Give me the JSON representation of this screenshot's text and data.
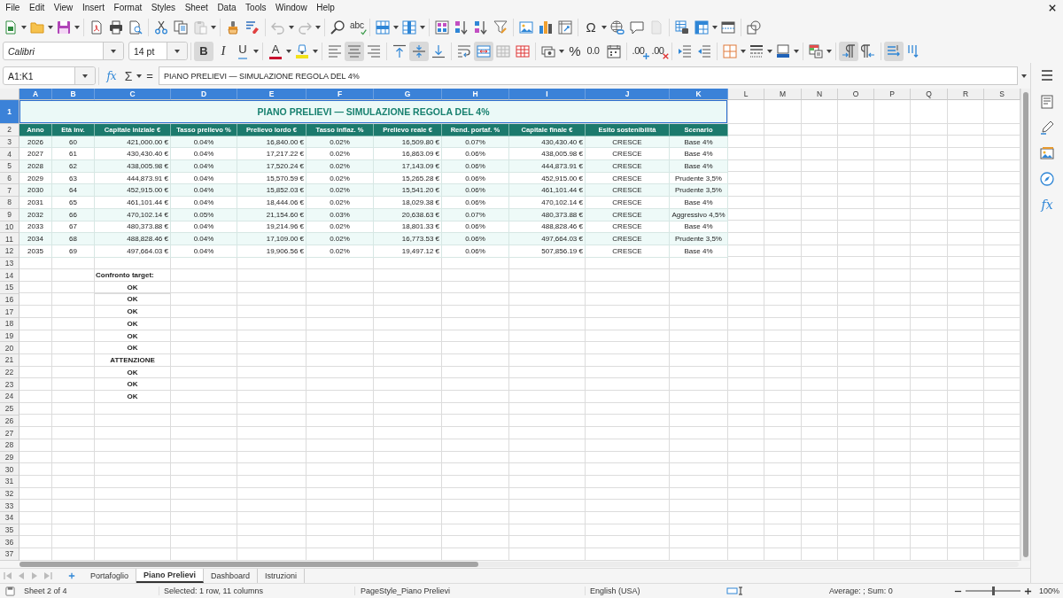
{
  "menu_bar": {
    "items": [
      "File",
      "Edit",
      "View",
      "Insert",
      "Format",
      "Styles",
      "Sheet",
      "Data",
      "Tools",
      "Window",
      "Help"
    ]
  },
  "standard_toolbar": [
    [
      {
        "kind": "new",
        "dropdown": true,
        "disabled": false
      },
      {
        "kind": "open",
        "dropdown": true,
        "disabled": false
      },
      {
        "kind": "save",
        "dropdown": true,
        "disabled": false
      }
    ],
    [
      {
        "kind": "pdf",
        "disabled": false
      },
      {
        "kind": "print",
        "disabled": false
      },
      {
        "kind": "preview",
        "disabled": false
      }
    ],
    [
      {
        "kind": "cut",
        "disabled": false
      },
      {
        "kind": "copy",
        "disabled": false
      },
      {
        "kind": "paste",
        "dropdown": true,
        "disabled": true
      }
    ],
    [
      {
        "kind": "clone",
        "disabled": false
      },
      {
        "kind": "clear",
        "disabled": false
      }
    ],
    [
      {
        "kind": "undo",
        "dropdown": true,
        "disabled": true
      },
      {
        "kind": "redo",
        "dropdown": true,
        "disabled": true
      }
    ],
    [
      {
        "kind": "find",
        "disabled": false
      },
      {
        "kind": "spelling",
        "glyph": "abc",
        "disabled": false
      }
    ],
    [
      {
        "kind": "row",
        "dropdown": true,
        "disabled": false
      },
      {
        "kind": "column",
        "dropdown": true,
        "disabled": false
      }
    ],
    [
      {
        "kind": "sort",
        "disabled": false
      },
      {
        "kind": "sort-asc",
        "disabled": false
      },
      {
        "kind": "sort-desc",
        "disabled": false
      },
      {
        "kind": "filter",
        "disabled": false
      }
    ],
    [
      {
        "kind": "image",
        "disabled": false
      },
      {
        "kind": "chart",
        "disabled": false
      },
      {
        "kind": "pivot",
        "disabled": false
      }
    ],
    [
      {
        "kind": "special",
        "glyph": "Ω",
        "dropdown": true,
        "disabled": false
      },
      {
        "kind": "link",
        "disabled": false
      },
      {
        "kind": "comment",
        "disabled": false
      },
      {
        "kind": "header",
        "disabled": true
      }
    ],
    [
      {
        "kind": "print-area",
        "disabled": false
      },
      {
        "kind": "freeze",
        "dropdown": true,
        "disabled": false
      },
      {
        "kind": "split",
        "disabled": false
      }
    ],
    [
      {
        "kind": "draw",
        "disabled": false
      }
    ]
  ],
  "formatting_toolbar": {
    "font_name": "Calibri",
    "font_size": "14 pt",
    "groups": [
      [
        {
          "kind": "bold",
          "glyph": "B",
          "pressed": true
        },
        {
          "kind": "italic",
          "glyph": "I",
          "pressed": false
        },
        {
          "kind": "underline",
          "glyph": "U",
          "dropdown": true,
          "pressed": false
        }
      ],
      [
        {
          "kind": "font-color",
          "glyph": "A",
          "dropdown": true,
          "pressed": false
        },
        {
          "kind": "highlight",
          "dropdown": true,
          "pressed": false
        }
      ],
      [
        {
          "kind": "align-left",
          "pressed": false
        },
        {
          "kind": "align-center",
          "pressed": true
        },
        {
          "kind": "align-right",
          "pressed": false
        }
      ],
      [
        {
          "kind": "align-top",
          "pressed": false
        },
        {
          "kind": "align-middle",
          "pressed": true
        },
        {
          "kind": "align-bottom",
          "pressed": false
        }
      ],
      [
        {
          "kind": "wrap",
          "pressed": false
        },
        {
          "kind": "merge-center",
          "pressed": true
        },
        {
          "kind": "merge",
          "pressed": false
        },
        {
          "kind": "unmerge",
          "pressed": false
        }
      ],
      [
        {
          "kind": "currency",
          "dropdown": true,
          "pressed": false
        },
        {
          "kind": "percent",
          "glyph": "%",
          "pressed": false
        },
        {
          "kind": "number",
          "glyph": "0.0",
          "pressed": false
        },
        {
          "kind": "date",
          "pressed": false
        }
      ],
      [
        {
          "kind": "add-decimal",
          "glyph": ".00",
          "pressed": false
        },
        {
          "kind": "delete-decimal",
          "glyph": ".00",
          "pressed": false
        }
      ],
      [
        {
          "kind": "indent",
          "pressed": false
        },
        {
          "kind": "outdent",
          "pressed": false
        }
      ],
      [
        {
          "kind": "borders",
          "dropdown": true,
          "pressed": false
        },
        {
          "kind": "border-style",
          "dropdown": true,
          "pressed": false
        },
        {
          "kind": "border-color",
          "dropdown": true,
          "pressed": false
        }
      ],
      [
        {
          "kind": "conditional",
          "dropdown": true,
          "pressed": false
        }
      ],
      [
        {
          "kind": "ltr",
          "pressed": true
        },
        {
          "kind": "rtl",
          "pressed": false
        }
      ],
      [
        {
          "kind": "text-ltr",
          "pressed": true
        },
        {
          "kind": "text-ttb",
          "pressed": false
        }
      ]
    ]
  },
  "formula_bar": {
    "name_box": "A1:K1",
    "wizard": "fx",
    "sum": "Σ",
    "equals": "=",
    "content": "PIANO PRELIEVI — SIMULAZIONE REGOLA DEL 4%"
  },
  "sidebar": [
    {
      "kind": "menu"
    },
    {
      "kind": "properties"
    },
    {
      "kind": "styles"
    },
    {
      "kind": "gallery"
    },
    {
      "kind": "navigator"
    },
    {
      "kind": "functions",
      "glyph": "fx"
    }
  ],
  "sheet": {
    "column_headers": [
      {
        "label": "A",
        "selected": true
      },
      {
        "label": "B",
        "selected": true
      },
      {
        "label": "C",
        "selected": true
      },
      {
        "label": "D",
        "selected": true
      },
      {
        "label": "E",
        "selected": true
      },
      {
        "label": "F",
        "selected": true
      },
      {
        "label": "G",
        "selected": true
      },
      {
        "label": "H",
        "selected": true
      },
      {
        "label": "I",
        "selected": true
      },
      {
        "label": "J",
        "selected": true
      },
      {
        "label": "K",
        "selected": true
      },
      {
        "label": "L",
        "selected": false
      },
      {
        "label": "M",
        "selected": false
      },
      {
        "label": "N",
        "selected": false
      },
      {
        "label": "O",
        "selected": false
      },
      {
        "label": "P",
        "selected": false
      },
      {
        "label": "Q",
        "selected": false
      },
      {
        "label": "R",
        "selected": false
      },
      {
        "label": "S",
        "selected": false
      }
    ],
    "row_headers": [
      {
        "label": "1",
        "selected": true
      },
      {
        "label": "2",
        "selected": false
      },
      {
        "label": "3",
        "selected": false
      },
      {
        "label": "4",
        "selected": false
      },
      {
        "label": "5",
        "selected": false
      },
      {
        "label": "6",
        "selected": false
      },
      {
        "label": "7",
        "selected": false
      },
      {
        "label": "8",
        "selected": false
      },
      {
        "label": "9",
        "selected": false
      },
      {
        "label": "10",
        "selected": false
      },
      {
        "label": "11",
        "selected": false
      },
      {
        "label": "12",
        "selected": false
      },
      {
        "label": "13",
        "selected": false
      },
      {
        "label": "14",
        "selected": false
      },
      {
        "label": "15",
        "selected": false
      },
      {
        "label": "16",
        "selected": false
      },
      {
        "label": "17",
        "selected": false
      },
      {
        "label": "18",
        "selected": false
      },
      {
        "label": "19",
        "selected": false
      },
      {
        "label": "20",
        "selected": false
      },
      {
        "label": "21",
        "selected": false
      },
      {
        "label": "22",
        "selected": false
      },
      {
        "label": "23",
        "selected": false
      },
      {
        "label": "24",
        "selected": false
      },
      {
        "label": "25",
        "selected": false
      },
      {
        "label": "26",
        "selected": false
      },
      {
        "label": "27",
        "selected": false
      },
      {
        "label": "28",
        "selected": false
      },
      {
        "label": "29",
        "selected": false
      },
      {
        "label": "30",
        "selected": false
      },
      {
        "label": "31",
        "selected": false
      },
      {
        "label": "32",
        "selected": false
      },
      {
        "label": "33",
        "selected": false
      },
      {
        "label": "34",
        "selected": false
      },
      {
        "label": "35",
        "selected": false
      },
      {
        "label": "36",
        "selected": false
      },
      {
        "label": "37",
        "selected": false
      }
    ],
    "title": {
      "text": "PIANO PRELIEVI — SIMULAZIONE REGOLA DEL 4%",
      "selected": true
    },
    "table": {
      "headings": [
        {
          "text": "Anno",
          "kind": "text"
        },
        {
          "text": "Età inv.",
          "kind": "text"
        },
        {
          "text": "Capitale iniziale €",
          "kind": "amount"
        },
        {
          "text": "Tasso prelievo %",
          "kind": "text"
        },
        {
          "text": "Prelievo lordo €",
          "kind": "amount"
        },
        {
          "text": "Tasso inflaz. %",
          "kind": "text"
        },
        {
          "text": "Prelievo reale €",
          "kind": "amount"
        },
        {
          "text": "Rend. portaf. %",
          "kind": "text"
        },
        {
          "text": "Capitale finale €",
          "kind": "amount"
        },
        {
          "text": "Esito sostenibilità",
          "kind": "text"
        },
        {
          "text": "Scenario",
          "kind": "text"
        }
      ],
      "rows": [
        [
          "2026",
          "60",
          "421,000.00 €",
          "0.04%",
          "16,840.00 €",
          "0.02%",
          "16,509.80 €",
          "0.07%",
          "430,430.40 €",
          "CRESCE",
          "Base 4%"
        ],
        [
          "2027",
          "61",
          "430,430.40 €",
          "0.04%",
          "17,217.22 €",
          "0.02%",
          "16,863.09 €",
          "0.06%",
          "438,005.98 €",
          "CRESCE",
          "Base 4%"
        ],
        [
          "2028",
          "62",
          "438,005.98 €",
          "0.04%",
          "17,520.24 €",
          "0.02%",
          "17,143.09 €",
          "0.06%",
          "444,873.91 €",
          "CRESCE",
          "Base 4%"
        ],
        [
          "2029",
          "63",
          "444,873.91 €",
          "0.04%",
          "15,570.59 €",
          "0.02%",
          "15,265.28 €",
          "0.06%",
          "452,915.00 €",
          "CRESCE",
          "Prudente 3,5%"
        ],
        [
          "2030",
          "64",
          "452,915.00 €",
          "0.04%",
          "15,852.03 €",
          "0.02%",
          "15,541.20 €",
          "0.06%",
          "461,101.44 €",
          "CRESCE",
          "Prudente 3,5%"
        ],
        [
          "2031",
          "65",
          "461,101.44 €",
          "0.04%",
          "18,444.06 €",
          "0.02%",
          "18,029.38 €",
          "0.06%",
          "470,102.14 €",
          "CRESCE",
          "Base 4%"
        ],
        [
          "2032",
          "66",
          "470,102.14 €",
          "0.05%",
          "21,154.60 €",
          "0.03%",
          "20,638.63 €",
          "0.07%",
          "480,373.88 €",
          "CRESCE",
          "Aggressivo 4,5%"
        ],
        [
          "2033",
          "67",
          "480,373.88 €",
          "0.04%",
          "19,214.96 €",
          "0.02%",
          "18,801.33 €",
          "0.06%",
          "488,828.46 €",
          "CRESCE",
          "Base 4%"
        ],
        [
          "2034",
          "68",
          "488,828.46 €",
          "0.04%",
          "17,109.00 €",
          "0.02%",
          "16,773.53 €",
          "0.06%",
          "497,664.03 €",
          "CRESCE",
          "Prudente 3,5%"
        ],
        [
          "2035",
          "69",
          "497,664.03 €",
          "0.04%",
          "19,906.56 €",
          "0.02%",
          "19,497.12 €",
          "0.06%",
          "507,856.19 €",
          "CRESCE",
          "Base 4%"
        ]
      ]
    },
    "check": {
      "label": "Confronto target:",
      "results": [
        "OK",
        "OK",
        "OK",
        "OK",
        "OK",
        "OK",
        "ATTENZIONE",
        "OK",
        "OK",
        "OK"
      ]
    }
  },
  "sheet_tabs": [
    {
      "label": "Portafoglio",
      "selected": false
    },
    {
      "label": "Piano Prelievi",
      "selected": true
    },
    {
      "label": "Dashboard",
      "selected": false
    },
    {
      "label": "Istruzioni",
      "selected": false
    }
  ],
  "status_bar": {
    "sheet": "Sheet 2 of 4",
    "selection": "Selected: 1 row, 11 columns",
    "page_style": "PageStyle_Piano Prelievi",
    "language": "English (USA)",
    "sum": "Average: ; Sum: 0",
    "zoom": {
      "level": 0.5,
      "label": "100%"
    }
  }
}
